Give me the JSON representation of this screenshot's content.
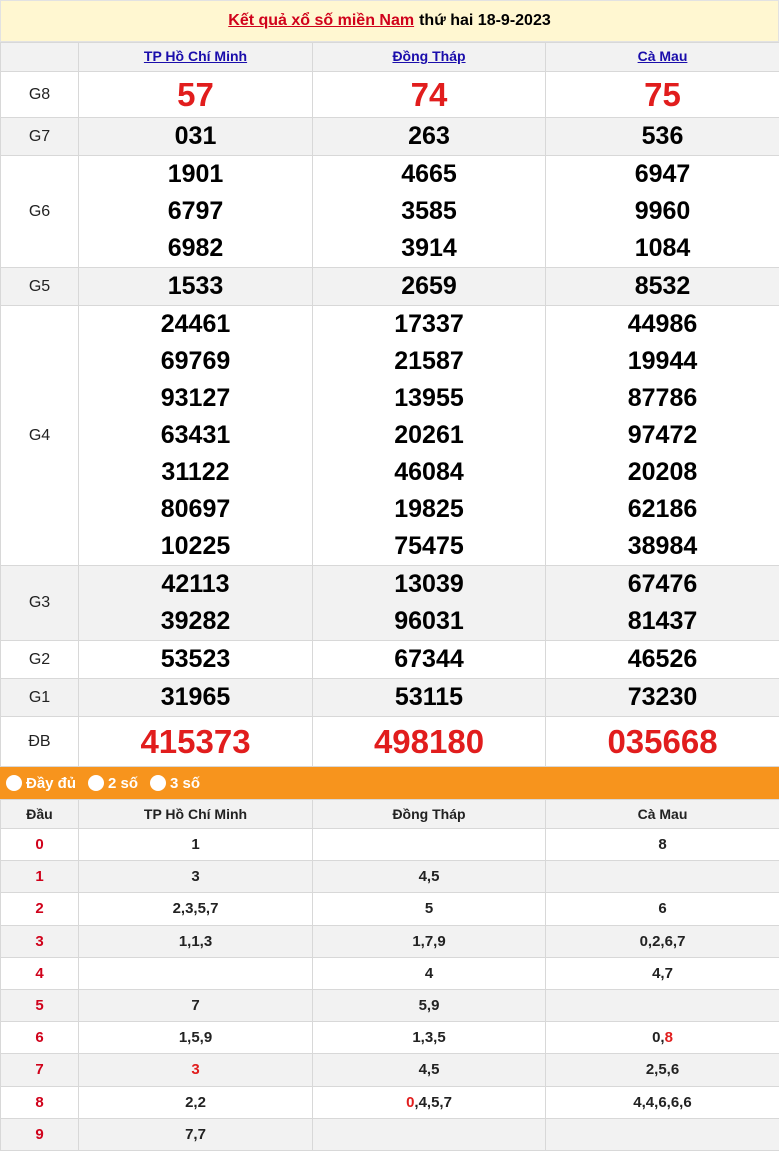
{
  "title": {
    "link_text": "Kết quả xổ số miền Nam",
    "date_text": "thứ hai 18-9-2023"
  },
  "provinces": [
    "TP Hồ Chí Minh",
    "Đồng Tháp",
    "Cà Mau"
  ],
  "prizes": [
    {
      "label": "G8",
      "values": [
        [
          "57"
        ],
        [
          "74"
        ],
        [
          "75"
        ]
      ]
    },
    {
      "label": "G7",
      "values": [
        [
          "031"
        ],
        [
          "263"
        ],
        [
          "536"
        ]
      ]
    },
    {
      "label": "G6",
      "values": [
        [
          "1901",
          "6797",
          "6982"
        ],
        [
          "4665",
          "3585",
          "3914"
        ],
        [
          "6947",
          "9960",
          "1084"
        ]
      ]
    },
    {
      "label": "G5",
      "values": [
        [
          "1533"
        ],
        [
          "2659"
        ],
        [
          "8532"
        ]
      ]
    },
    {
      "label": "G4",
      "values": [
        [
          "24461",
          "69769",
          "93127",
          "63431",
          "31122",
          "80697",
          "10225"
        ],
        [
          "17337",
          "21587",
          "13955",
          "20261",
          "46084",
          "19825",
          "75475"
        ],
        [
          "44986",
          "19944",
          "87786",
          "97472",
          "20208",
          "62186",
          "38984"
        ]
      ]
    },
    {
      "label": "G3",
      "values": [
        [
          "42113",
          "39282"
        ],
        [
          "13039",
          "96031"
        ],
        [
          "67476",
          "81437"
        ]
      ]
    },
    {
      "label": "G2",
      "values": [
        [
          "53523"
        ],
        [
          "67344"
        ],
        [
          "46526"
        ]
      ]
    },
    {
      "label": "G1",
      "values": [
        [
          "31965"
        ],
        [
          "53115"
        ],
        [
          "73230"
        ]
      ]
    },
    {
      "label": "ĐB",
      "values": [
        [
          "415373"
        ],
        [
          "498180"
        ],
        [
          "035668"
        ]
      ]
    }
  ],
  "options": [
    "Đầy đủ",
    "2 số",
    "3 số"
  ],
  "loto": {
    "header_dau": "Đầu",
    "rows": [
      {
        "dau": "0",
        "cells": [
          [
            "1"
          ],
          [],
          [
            "8"
          ]
        ]
      },
      {
        "dau": "1",
        "cells": [
          [
            "3"
          ],
          [
            "4,5"
          ],
          []
        ]
      },
      {
        "dau": "2",
        "cells": [
          [
            "2,3,5,7"
          ],
          [
            "5"
          ],
          [
            "6"
          ]
        ]
      },
      {
        "dau": "3",
        "cells": [
          [
            "1,1,3"
          ],
          [
            "1,7,9"
          ],
          [
            "0,2,6,7"
          ]
        ]
      },
      {
        "dau": "4",
        "cells": [
          [],
          [
            "4"
          ],
          [
            "4,7"
          ]
        ]
      },
      {
        "dau": "5",
        "cells": [
          [
            "7"
          ],
          [
            "5,9"
          ],
          []
        ]
      },
      {
        "dau": "6",
        "cells": [
          [
            "1,5,9"
          ],
          [
            "1,3,5"
          ],
          [
            "0,",
            "8"
          ]
        ]
      },
      {
        "dau": "7",
        "cells": [
          [
            "3"
          ],
          [
            "4,5"
          ],
          [
            "2,5,6"
          ]
        ]
      },
      {
        "dau": "8",
        "cells": [
          [
            "2,2"
          ],
          [
            "0",
            ",4,5,7"
          ],
          [
            "4,4,6,6,6"
          ]
        ]
      },
      {
        "dau": "9",
        "cells": [
          [
            "7,7"
          ],
          [],
          []
        ]
      }
    ],
    "highlight": [
      {
        "row": 6,
        "col": 2,
        "part": 1
      },
      {
        "row": 7,
        "col": 0,
        "part": 0
      },
      {
        "row": 8,
        "col": 1,
        "part": 0
      }
    ]
  },
  "colors": {
    "accent_red": "#e11d1d",
    "option_bar": "#f7941d",
    "title_bg": "#fff7d1",
    "link_blue": "#1a0dab"
  }
}
